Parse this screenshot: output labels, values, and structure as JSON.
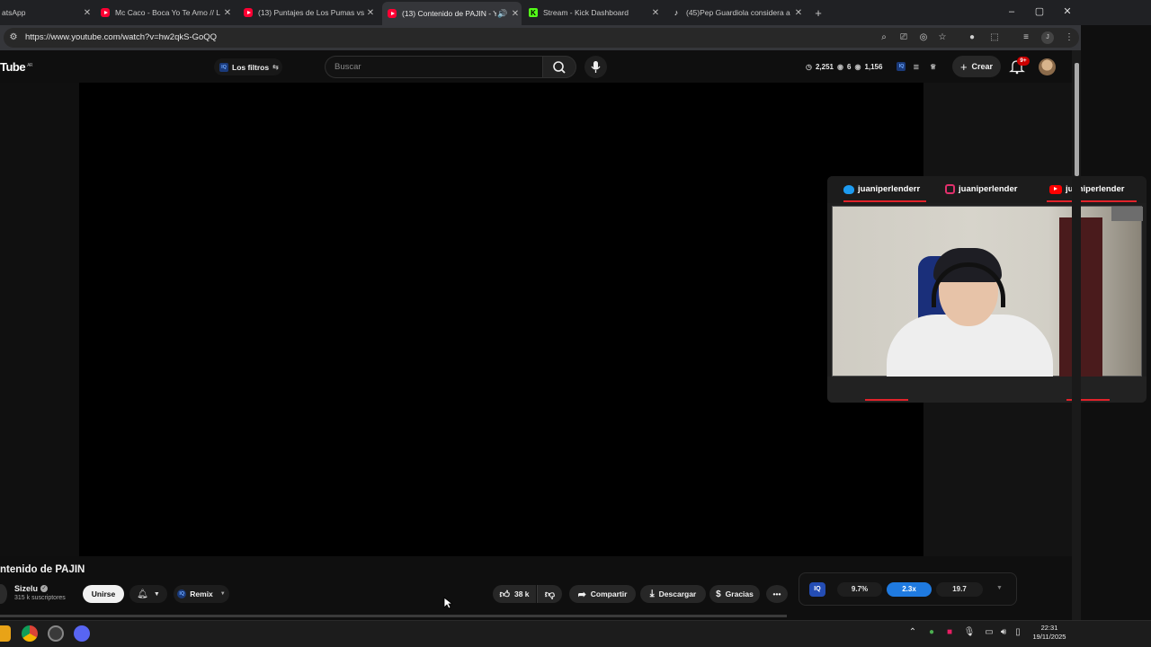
{
  "browser": {
    "tabs": [
      {
        "title": "atsApp",
        "favicon": "whatsapp-icon"
      },
      {
        "title": "Mc Caco - Boca Yo Te Amo // L",
        "favicon": "youtube-icon"
      },
      {
        "title": "(13) Puntajes de Los Pumas vs F",
        "favicon": "youtube-icon"
      },
      {
        "title": "(13) Contenido de PAJIN - Y",
        "favicon": "youtube-icon",
        "active": true
      },
      {
        "title": "Stream - Kick Dashboard",
        "favicon": "kick-icon"
      },
      {
        "title": "(45)Pep Guardiola considera a l",
        "favicon": "tiktok-icon"
      }
    ],
    "new_tab": "+",
    "window_controls": {
      "minimize": "–",
      "maximize": "▢",
      "close": "✕"
    },
    "url": "https://www.youtube.com/watch?v=hw2qkS-GoQQ"
  },
  "youtube": {
    "logo": "Tube",
    "region": "AR",
    "filters_label": "Los filtros",
    "search_placeholder": "Buscar",
    "stats": {
      "views": "2,251",
      "mid": "6",
      "right": "1,156"
    },
    "create_label": "Crear",
    "notifications": "9+"
  },
  "facecam": {
    "twitter": "juaniperlenderr",
    "instagram": "juaniperlender",
    "youtube": "juaniperlender"
  },
  "video": {
    "title": "ntenido de PAJIN",
    "channel": "Sizelu",
    "subscribers": "315 k suscriptores",
    "join_label": "Unirse",
    "remix_label": "Remix",
    "likes": "38 k",
    "share_label": "Compartir",
    "download_label": "Descargar",
    "thanks_label": "Gracias"
  },
  "extension": {
    "logo": "IQ",
    "value1": "9.7%",
    "value2": "2.3x",
    "value3": "19.7"
  },
  "taskbar": {
    "time": "22:31",
    "date": "19/11/2025"
  },
  "colors": {
    "accent_blue": "#1f7ae0",
    "youtube_red": "#ff0033",
    "kick_green": "#53fc18",
    "facecam_red": "#e0222a"
  }
}
